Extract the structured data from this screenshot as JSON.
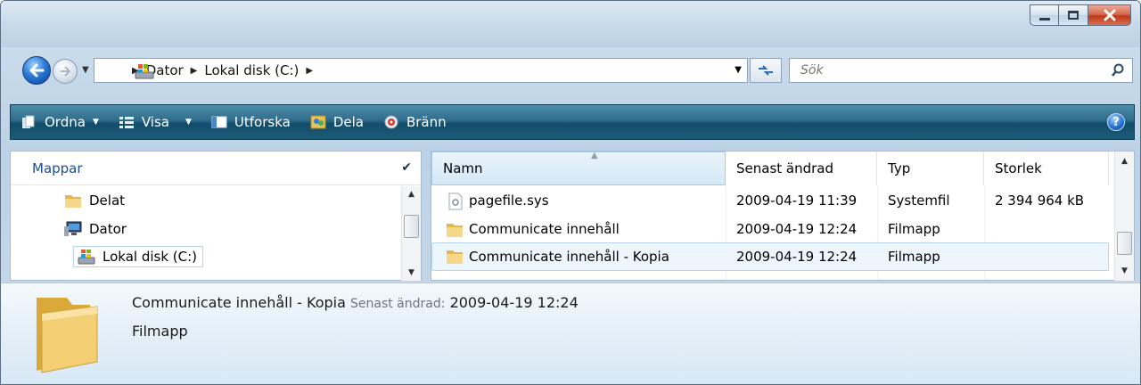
{
  "nav": {
    "breadcrumbs": [
      "Dator",
      "Lokal disk (C:)"
    ],
    "search_placeholder": "Sök"
  },
  "toolbar": {
    "organize": "Ordna",
    "views": "Visa",
    "explore": "Utforska",
    "share": "Dela",
    "burn": "Bränn",
    "help": "?"
  },
  "folders": {
    "header": "Mappar",
    "items": [
      {
        "label": "Delat",
        "icon": "folder-icon"
      },
      {
        "label": "Dator",
        "icon": "computer-icon"
      },
      {
        "label": "Lokal disk (C:)",
        "icon": "drive-icon"
      }
    ]
  },
  "files": {
    "columns": [
      "Namn",
      "Senast ändrad",
      "Typ",
      "Storlek"
    ],
    "rows": [
      {
        "name": "pagefile.sys",
        "modified": "2009-04-19 11:39",
        "type": "Systemfil",
        "size": "2 394 964 kB",
        "icon": "system-file-icon"
      },
      {
        "name": "Communicate innehåll",
        "modified": "2009-04-19 12:24",
        "type": "Filmapp",
        "size": "",
        "icon": "folder-icon"
      },
      {
        "name": "Communicate innehåll - Kopia",
        "modified": "2009-04-19 12:24",
        "type": "Filmapp",
        "size": "",
        "icon": "folder-icon"
      }
    ]
  },
  "details": {
    "name": "Communicate innehåll - Kopia",
    "modified_label": "Senast ändrad:",
    "modified_value": "2009-04-19 12:24",
    "type": "Filmapp"
  },
  "colors": {
    "cmdbar": "#1d5c79",
    "link": "#1e4c96",
    "selection": "#eef6fd"
  }
}
